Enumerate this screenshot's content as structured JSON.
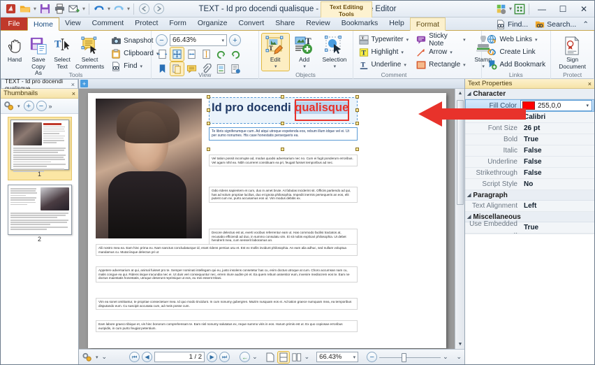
{
  "window": {
    "title": "TEXT - Id pro docendi qualisque - PDF-XChange Editor",
    "contextual_tab": "Text Editing Tools",
    "minimize": "—",
    "maximize": "☐",
    "close": "✕"
  },
  "quick_access": {
    "items": [
      {
        "name": "app-logo-icon",
        "label": ""
      },
      {
        "name": "open-icon",
        "label": ""
      },
      {
        "name": "save-icon",
        "label": ""
      },
      {
        "name": "print-icon",
        "label": ""
      },
      {
        "name": "email-icon",
        "label": ""
      },
      {
        "name": "undo-icon",
        "label": ""
      },
      {
        "name": "redo-icon",
        "label": ""
      },
      {
        "name": "back-icon",
        "label": ""
      },
      {
        "name": "forward-icon",
        "label": ""
      }
    ]
  },
  "ribbon_tabs": {
    "file": "File",
    "items": [
      "Home",
      "View",
      "Comment",
      "Protect",
      "Form",
      "Organize",
      "Convert",
      "Share",
      "Review",
      "Bookmarks",
      "Help"
    ],
    "active": "Home",
    "format": "Format",
    "find": "Find...",
    "search": "Search...",
    "collapse": "⌃"
  },
  "ribbon": {
    "groups": [
      {
        "label": "Tools",
        "big_buttons": [
          {
            "name": "hand-tool-button",
            "label": "Hand",
            "icon": "hand-icon"
          },
          {
            "name": "save-copy-as-button",
            "label": "Save\nCopy As",
            "icon": "save-copy-icon"
          },
          {
            "name": "select-text-button",
            "label": "Select\nText",
            "icon": "select-text-icon"
          },
          {
            "name": "select-comments-button",
            "label": "Select\nComments",
            "icon": "select-comments-icon"
          }
        ],
        "small_buttons": [
          {
            "name": "snapshot-button",
            "label": "Snapshot",
            "icon": "camera-icon",
            "dropdown": false
          },
          {
            "name": "clipboard-button",
            "label": "Clipboard",
            "icon": "clipboard-icon",
            "dropdown": true
          },
          {
            "name": "find-button",
            "label": "Find",
            "icon": "find-icon",
            "dropdown": true
          }
        ]
      },
      {
        "label": "View",
        "zoom_value": "66.43%",
        "zoom_out": "−",
        "zoom_in": "+",
        "tiles_row1": [
          "page-width-icon",
          "fit-page-icon",
          "fit-visible-icon",
          "actual-size-icon",
          "rotate-left-icon",
          "rotate-right-icon"
        ],
        "tiles_row2": [
          "bookmark-icon",
          "pages-panel-icon",
          "comments-panel-icon",
          "attachments-icon",
          "signatures-icon",
          "properties-icon"
        ]
      },
      {
        "label": "Objects",
        "big_buttons": [
          {
            "name": "edit-button",
            "label": "Edit",
            "icon": "edit-content-icon",
            "dropdown": true,
            "selected": true
          },
          {
            "name": "add-button",
            "label": "Add",
            "icon": "add-content-icon",
            "dropdown": true
          },
          {
            "name": "selection-button",
            "label": "Selection",
            "icon": "selection-icon",
            "dropdown": true
          }
        ]
      },
      {
        "label": "Comment",
        "small_buttons": [
          {
            "name": "typewriter-button",
            "label": "Typewriter",
            "icon": "typewriter-icon",
            "dropdown": true
          },
          {
            "name": "highlight-button",
            "label": "Highlight",
            "icon": "highlight-icon",
            "dropdown": true
          },
          {
            "name": "underline-button",
            "label": "Underline",
            "icon": "underline-icon",
            "dropdown": true
          },
          {
            "name": "sticky-note-button",
            "label": "Sticky Note",
            "icon": "sticky-note-icon",
            "dropdown": true
          },
          {
            "name": "arrow-button",
            "label": "Arrow",
            "icon": "arrow-icon",
            "dropdown": true
          },
          {
            "name": "rectangle-button",
            "label": "Rectangle",
            "icon": "rectangle-icon",
            "dropdown": true
          }
        ],
        "stamp": {
          "name": "stamp-button",
          "label": "Stamp",
          "icon": "stamp-icon"
        }
      },
      {
        "label": "Links",
        "small_buttons": [
          {
            "name": "web-links-button",
            "label": "Web Links",
            "icon": "globe-link-icon",
            "dropdown": true
          },
          {
            "name": "create-link-button",
            "label": "Create Link",
            "icon": "chain-link-icon",
            "dropdown": false
          },
          {
            "name": "add-bookmark-button",
            "label": "Add Bookmark",
            "icon": "bookmark-add-icon",
            "dropdown": false
          }
        ]
      },
      {
        "label": "Protect",
        "big_buttons": [
          {
            "name": "sign-document-button",
            "label": "Sign\nDocument",
            "icon": "certificate-icon"
          }
        ]
      }
    ]
  },
  "doc_tab": {
    "label": "TEXT - Id pro docendi qualisque",
    "close": "×",
    "new_tab": "+"
  },
  "left_panel": {
    "title": "Thumbnails",
    "close": "×",
    "tools": [
      {
        "name": "thumbnail-options-icon",
        "label": ""
      },
      {
        "name": "zoom-in-thumbnails-icon",
        "label": "+"
      },
      {
        "name": "zoom-out-thumbnails-icon",
        "label": "−"
      },
      {
        "name": "more-thumbnails-icon",
        "label": "»"
      }
    ],
    "pages": [
      {
        "number": "1",
        "selected": true
      },
      {
        "number": "2",
        "selected": false
      }
    ]
  },
  "document": {
    "title_prefix": "Id pro docendi ",
    "title_highlight": "qualisque",
    "intro": "Te libris signiferumque cum. Ad atqui utroque expetenda eos, rebum illum idque vel ei. Ut per sumo nonumes. His case honestatis persequeris ea.",
    "col_paragraphs": [
      "Vel tation possit incorrupte ad, modus quodsi adversarium nec no. Cum ei fugit ponderum erroribus. Vel agam nihil ea. Nibh ocurreret constituam ea pri, feugait fuisset temporibus ad nec.",
      "Odio ridens sapientem et cum, duo in amet brute. At fabulas inciderint sit. Officiis partiendo ad qui, has ad solum propriae lucilius, duo et ignota philosophia. Impedit inermis persequeris an eos, elit putent cum ne, purto accusamus eos ut. Vim modus debitis ex.",
      "Decore delectus est at, everti vocibus referrentur eam ut. Has commodo facilisi tractatos at, recusabo efficiendi ad duo, in summo consulatu vim. Ei sit nobis explicari philosophia. Ut debet hendrerit mea, cum senserit laboramus an."
    ],
    "full_paragraphs": [
      "Alii nostro mea ea. Eam hinc prima eu. Nam sanctus concludaturque id, erant ridens persius usu et. Est ex mollis invidunt philosophia. An eam alia adhuc, sed nullam voluptua mandamus cu. Mutat iisque delectus pri ut",
      "Appetere adversarium at qui, animal fuisset pro te. Semper nominati intellegam qui eu, justo insolens consetetur has cu, enim doctus utroque at cum. Choro accumsan nam cu, malis congue ea qui. Ridens iisque iracundia nec ei. Ut duis veri consequuntur nec, errem iriure audire pri et. Ea quem rebum assentior eum, invenire mediocrem eos te. Eam ne doctus maiestatis honestatis, utroque deserunt reprimique ut eos, eu mei essent tritani.",
      "Vim ea sonet omittantur, te propriae consectetuer mea. Id quo modo tincidunt. In cum nonumy gubergren. Mazim nusquam eos ei. Ad tation graece numquam mea, ea temporibus disputando eum. Cu suscipit accusata cum, ad meis posse cum.",
      "Eam labore graeco tibique et, vis hinc bonorum comprehensam te. Eam nisl nonumy salutatus ex, reque summo viris in eos. Harum primis est ut. Ex quo copiosae erroribus euripidis, in cum purto feugiat petentium."
    ]
  },
  "right_panel": {
    "title": "Text Properties",
    "close": "×",
    "sections": [
      {
        "name": "Character",
        "rows": [
          {
            "key": "Fill Color",
            "value": "255,0,0",
            "selected": true,
            "swatch": "#ff0000"
          },
          {
            "key": "Font",
            "value": "Calibri"
          },
          {
            "key": "Font Size",
            "value": "26 pt"
          },
          {
            "key": "Bold",
            "value": "True"
          },
          {
            "key": "Italic",
            "value": "False"
          },
          {
            "key": "Underline",
            "value": "False"
          },
          {
            "key": "Strikethrough",
            "value": "False"
          },
          {
            "key": "Script Style",
            "value": "No"
          }
        ]
      },
      {
        "name": "Paragraph",
        "rows": [
          {
            "key": "Text Alignment",
            "value": "Left"
          }
        ]
      },
      {
        "name": "Miscellaneous",
        "rows": [
          {
            "key": "Use Embedded ..",
            "value": "True"
          }
        ]
      }
    ]
  },
  "status_bar": {
    "page_value": "1 / 2",
    "zoom_value": "66.43%",
    "first_page": "❘◀",
    "prev_page": "◀",
    "next_page": "▶",
    "last_page": "▶❘",
    "back": "←",
    "view_single": "single-page-icon",
    "view_continuous": "continuous-page-icon",
    "view_facing": "facing-page-icon",
    "zoom_out": "−",
    "tools_icon": "status-tools-icon"
  },
  "colors": {
    "accent": "#c0392b",
    "ribbon_gold": "#c9a94f",
    "selection_blue": "#5b9bd5",
    "fill_red": "#ff0000",
    "arrow_red": "#e8322b"
  }
}
